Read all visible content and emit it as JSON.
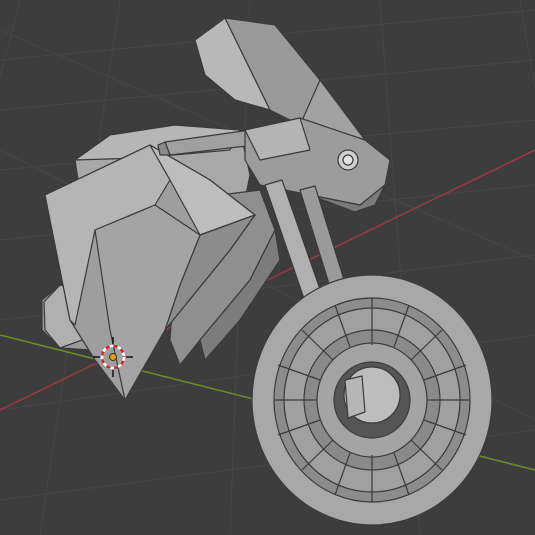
{
  "viewport": {
    "background": "#3d3d3d",
    "grid_color": "#4a4a4a",
    "x_axis_color": "#9b3a44",
    "y_axis_color": "#6b8f2e"
  },
  "scene": {
    "object": "motorcycle-lowpoly-mesh",
    "shading": "solid",
    "base_color": "#a6a6a6",
    "edge_color": "#3a3a3a"
  },
  "cursor_3d": {
    "icon": "3d-cursor-icon",
    "ring_colors": [
      "#d9232d",
      "#ffffff"
    ],
    "crosshair_color": "#111111"
  }
}
